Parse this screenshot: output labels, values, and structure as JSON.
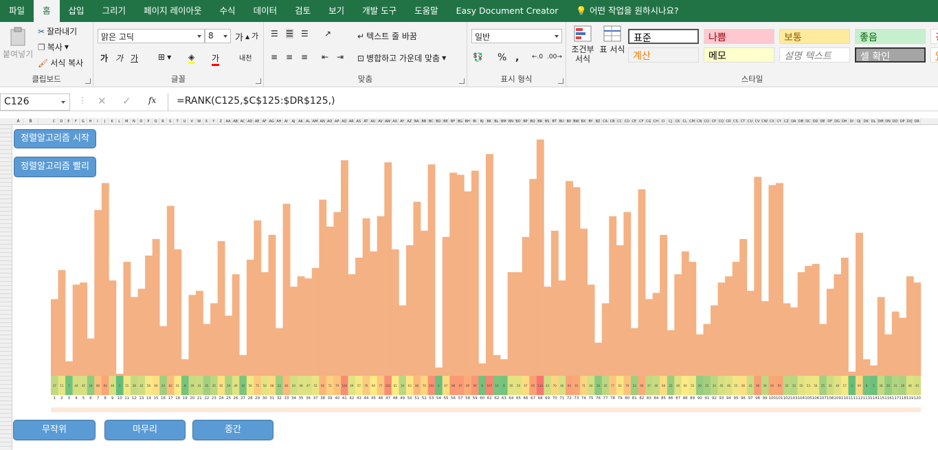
{
  "tabs": [
    {
      "label": "파일",
      "active": false
    },
    {
      "label": "홈",
      "active": true
    },
    {
      "label": "삽입",
      "active": false
    },
    {
      "label": "그리기",
      "active": false
    },
    {
      "label": "페이지 레이아웃",
      "active": false
    },
    {
      "label": "수식",
      "active": false
    },
    {
      "label": "데이터",
      "active": false
    },
    {
      "label": "검토",
      "active": false
    },
    {
      "label": "보기",
      "active": false
    },
    {
      "label": "개발 도구",
      "active": false
    },
    {
      "label": "도움말",
      "active": false
    },
    {
      "label": "Easy Document Creator",
      "active": false
    }
  ],
  "tell_me": "어떤 작업을 원하시나요?",
  "ribbon": {
    "clipboard": {
      "label": "클립보드",
      "paste": "붙여넣기",
      "cut": "잘라내기",
      "copy": "복사",
      "format_painter": "서식 복사"
    },
    "font": {
      "label": "글꼴",
      "font_name": "맑은 고딕",
      "font_size": "8",
      "bold": "가",
      "italic": "가",
      "underline": "가",
      "increase": "가",
      "decrease": "가",
      "font_color": "가",
      "phonetic": "내천"
    },
    "alignment": {
      "label": "맞춤",
      "wrap_text": "텍스트 줄 바꿈",
      "merge_center": "병합하고 가운데 맞춤"
    },
    "number": {
      "label": "표시 형식",
      "format": "일반",
      "percent": "%",
      "comma": ","
    },
    "styles": {
      "label": "스타일",
      "conditional": "조건부 서식",
      "table": "표 서식",
      "cells": [
        {
          "text": "표준",
          "bg": "#ffffff",
          "fg": "#000000"
        },
        {
          "text": "나쁨",
          "bg": "#ffc7ce",
          "fg": "#9c0006"
        },
        {
          "text": "보통",
          "bg": "#ffeb9c",
          "fg": "#9c5700"
        },
        {
          "text": "좋음",
          "bg": "#c6efce",
          "fg": "#006100"
        },
        {
          "text": "경고",
          "bg": "#ffffff",
          "fg": "#ff0000"
        },
        {
          "text": "계산",
          "bg": "#f2f2f2",
          "fg": "#fa7d00"
        },
        {
          "text": "메모",
          "bg": "#ffffcc",
          "fg": "#000000"
        },
        {
          "text": "설명 텍스트",
          "bg": "#ffffff",
          "fg": "#7f7f7f"
        },
        {
          "text": "셀 확인",
          "bg": "#a5a5a5",
          "fg": "#ffffff"
        },
        {
          "text": "연결",
          "bg": "#ffffff",
          "fg": "#fa7d00"
        }
      ]
    }
  },
  "formula_bar": {
    "name_box": "C126",
    "fx": "fx",
    "formula": "=RANK(C125,$C$125:$DR$125,)"
  },
  "buttons": {
    "start": "정렬알고리즘 시작",
    "fast": "정렬알고리즘 빨리",
    "random": "무작위",
    "finish": "마무리",
    "middle": "중간"
  },
  "colors": {
    "accent": "#217346",
    "bar": "#f4b183",
    "button": "#5b9bd5"
  },
  "chart_data": {
    "type": "bar",
    "x": [
      1,
      2,
      3,
      4,
      5,
      6,
      7,
      8,
      9,
      10,
      11,
      12,
      13,
      14,
      15,
      16,
      17,
      18,
      19,
      20,
      21,
      22,
      23,
      24,
      25,
      26,
      27,
      28,
      29,
      30,
      31,
      32,
      33,
      34,
      35,
      36,
      37,
      38,
      39,
      40,
      41,
      42,
      43,
      44,
      45,
      46,
      47,
      48,
      49,
      50,
      51,
      52,
      53,
      54,
      55,
      56,
      57,
      58,
      59,
      60,
      61,
      62,
      63,
      64,
      65,
      66,
      67,
      68,
      69,
      70,
      71,
      72,
      73,
      74,
      75,
      76,
      77,
      78,
      79,
      80,
      81,
      82,
      83,
      84,
      85,
      86,
      87,
      88,
      89,
      90,
      91,
      92,
      93,
      94,
      95,
      96,
      97,
      98,
      99,
      100,
      101,
      102,
      103,
      104,
      105,
      106,
      107,
      108,
      109,
      110,
      111,
      112,
      113,
      114,
      115,
      116,
      117,
      118,
      119,
      120
    ],
    "values": [
      37,
      51,
      7,
      44,
      45,
      18,
      80,
      93,
      46,
      1,
      55,
      38,
      42,
      58,
      66,
      24,
      82,
      61,
      8,
      39,
      41,
      25,
      35,
      65,
      29,
      49,
      10,
      56,
      75,
      50,
      68,
      23,
      83,
      43,
      48,
      47,
      52,
      85,
      72,
      79,
      104,
      49,
      57,
      76,
      60,
      77,
      103,
      61,
      34,
      63,
      84,
      70,
      102,
      4,
      67,
      98,
      97,
      89,
      99,
      6,
      107,
      10,
      8,
      50,
      50,
      67,
      95,
      114,
      43,
      70,
      46,
      94,
      91,
      71,
      44,
      16,
      35,
      77,
      63,
      79,
      23,
      90,
      37,
      40,
      68,
      22,
      49,
      60,
      55,
      20,
      25,
      34,
      45,
      48,
      55,
      66,
      41,
      96,
      36,
      92,
      93,
      35,
      33,
      50,
      53,
      54,
      25,
      42,
      49,
      57,
      2,
      69,
      8,
      5,
      38,
      20,
      31,
      28,
      48,
      45
    ],
    "ylim": [
      0,
      120
    ]
  }
}
